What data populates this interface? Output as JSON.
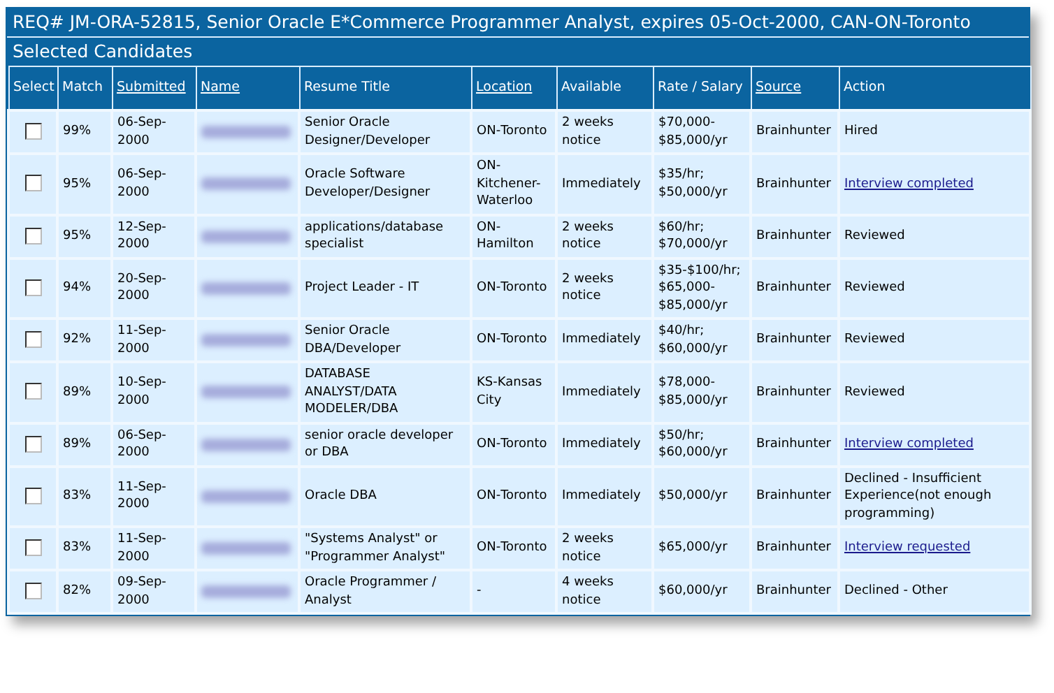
{
  "title": "REQ# JM-ORA-52815, Senior Oracle E*Commerce Programmer Analyst, expires 05-Oct-2000, CAN-ON-Toronto",
  "subtitle": "Selected Candidates",
  "columns": [
    {
      "label": "Select",
      "sortable": false
    },
    {
      "label": "Match",
      "sortable": false
    },
    {
      "label": "Submitted",
      "sortable": true
    },
    {
      "label": "Name",
      "sortable": true
    },
    {
      "label": "Resume Title",
      "sortable": false
    },
    {
      "label": "Location",
      "sortable": true
    },
    {
      "label": "Available",
      "sortable": false
    },
    {
      "label": "Rate / Salary",
      "sortable": false
    },
    {
      "label": "Source",
      "sortable": true
    },
    {
      "label": "Action",
      "sortable": false
    }
  ],
  "rows": [
    {
      "checked": false,
      "match": "99%",
      "submitted": "06-Sep-2000",
      "title": "Senior Oracle Designer/Developer",
      "location": "ON-Toronto",
      "available": "2 weeks notice",
      "rate": "$70,000-$85,000/yr",
      "source": "Brainhunter",
      "action": "Hired",
      "kind": "text"
    },
    {
      "checked": false,
      "match": "95%",
      "submitted": "06-Sep-2000",
      "title": "Oracle Software Developer/Designer",
      "location": "ON-Kitchener-Waterloo",
      "available": "Immediately",
      "rate": "$35/hr; $50,000/yr",
      "source": "Brainhunter",
      "action": "Interview completed",
      "kind": "link"
    },
    {
      "checked": false,
      "match": "95%",
      "submitted": "12-Sep-2000",
      "title": "applications/database specialist",
      "location": "ON-Hamilton",
      "available": "2 weeks notice",
      "rate": "$60/hr; $70,000/yr",
      "source": "Brainhunter",
      "action": "Reviewed",
      "kind": "text"
    },
    {
      "checked": false,
      "match": "94%",
      "submitted": "20-Sep-2000",
      "title": "Project Leader - IT",
      "location": "ON-Toronto",
      "available": "2 weeks notice",
      "rate": "$35-$100/hr; $65,000-$85,000/yr",
      "source": "Brainhunter",
      "action": "Reviewed",
      "kind": "text"
    },
    {
      "checked": false,
      "match": "92%",
      "submitted": "11-Sep-2000",
      "title": "Senior Oracle DBA/Developer",
      "location": "ON-Toronto",
      "available": "Immediately",
      "rate": "$40/hr; $60,000/yr",
      "source": "Brainhunter",
      "action": "Reviewed",
      "kind": "text"
    },
    {
      "checked": false,
      "match": "89%",
      "submitted": "10-Sep-2000",
      "title": "DATABASE ANALYST/DATA MODELER/DBA",
      "location": "KS-Kansas City",
      "available": "Immediately",
      "rate": "$78,000-$85,000/yr",
      "source": "Brainhunter",
      "action": "Reviewed",
      "kind": "text"
    },
    {
      "checked": false,
      "match": "89%",
      "submitted": "06-Sep-2000",
      "title": "senior oracle developer or DBA",
      "location": "ON-Toronto",
      "available": "Immediately",
      "rate": "$50/hr; $60,000/yr",
      "source": "Brainhunter",
      "action": "Interview completed",
      "kind": "link"
    },
    {
      "checked": false,
      "match": "83%",
      "submitted": "11-Sep-2000",
      "title": "Oracle DBA",
      "location": "ON-Toronto",
      "available": "Immediately",
      "rate": "$50,000/yr",
      "source": "Brainhunter",
      "action": "Declined - Insufficient Experience(not enough programming)",
      "kind": "text"
    },
    {
      "checked": false,
      "match": "83%",
      "submitted": "11-Sep-2000",
      "title": "\"Systems Analyst\" or \"Programmer Analyst\"",
      "location": "ON-Toronto",
      "available": "2 weeks notice",
      "rate": "$65,000/yr",
      "source": "Brainhunter",
      "action": "Interview requested",
      "kind": "link"
    },
    {
      "checked": false,
      "match": "82%",
      "submitted": "09-Sep-2000",
      "title": "Oracle Programmer / Analyst",
      "location": "-",
      "available": "4 weeks notice",
      "rate": "$60,000/yr",
      "source": "Brainhunter",
      "action": "Declined - Other",
      "kind": "text"
    }
  ]
}
